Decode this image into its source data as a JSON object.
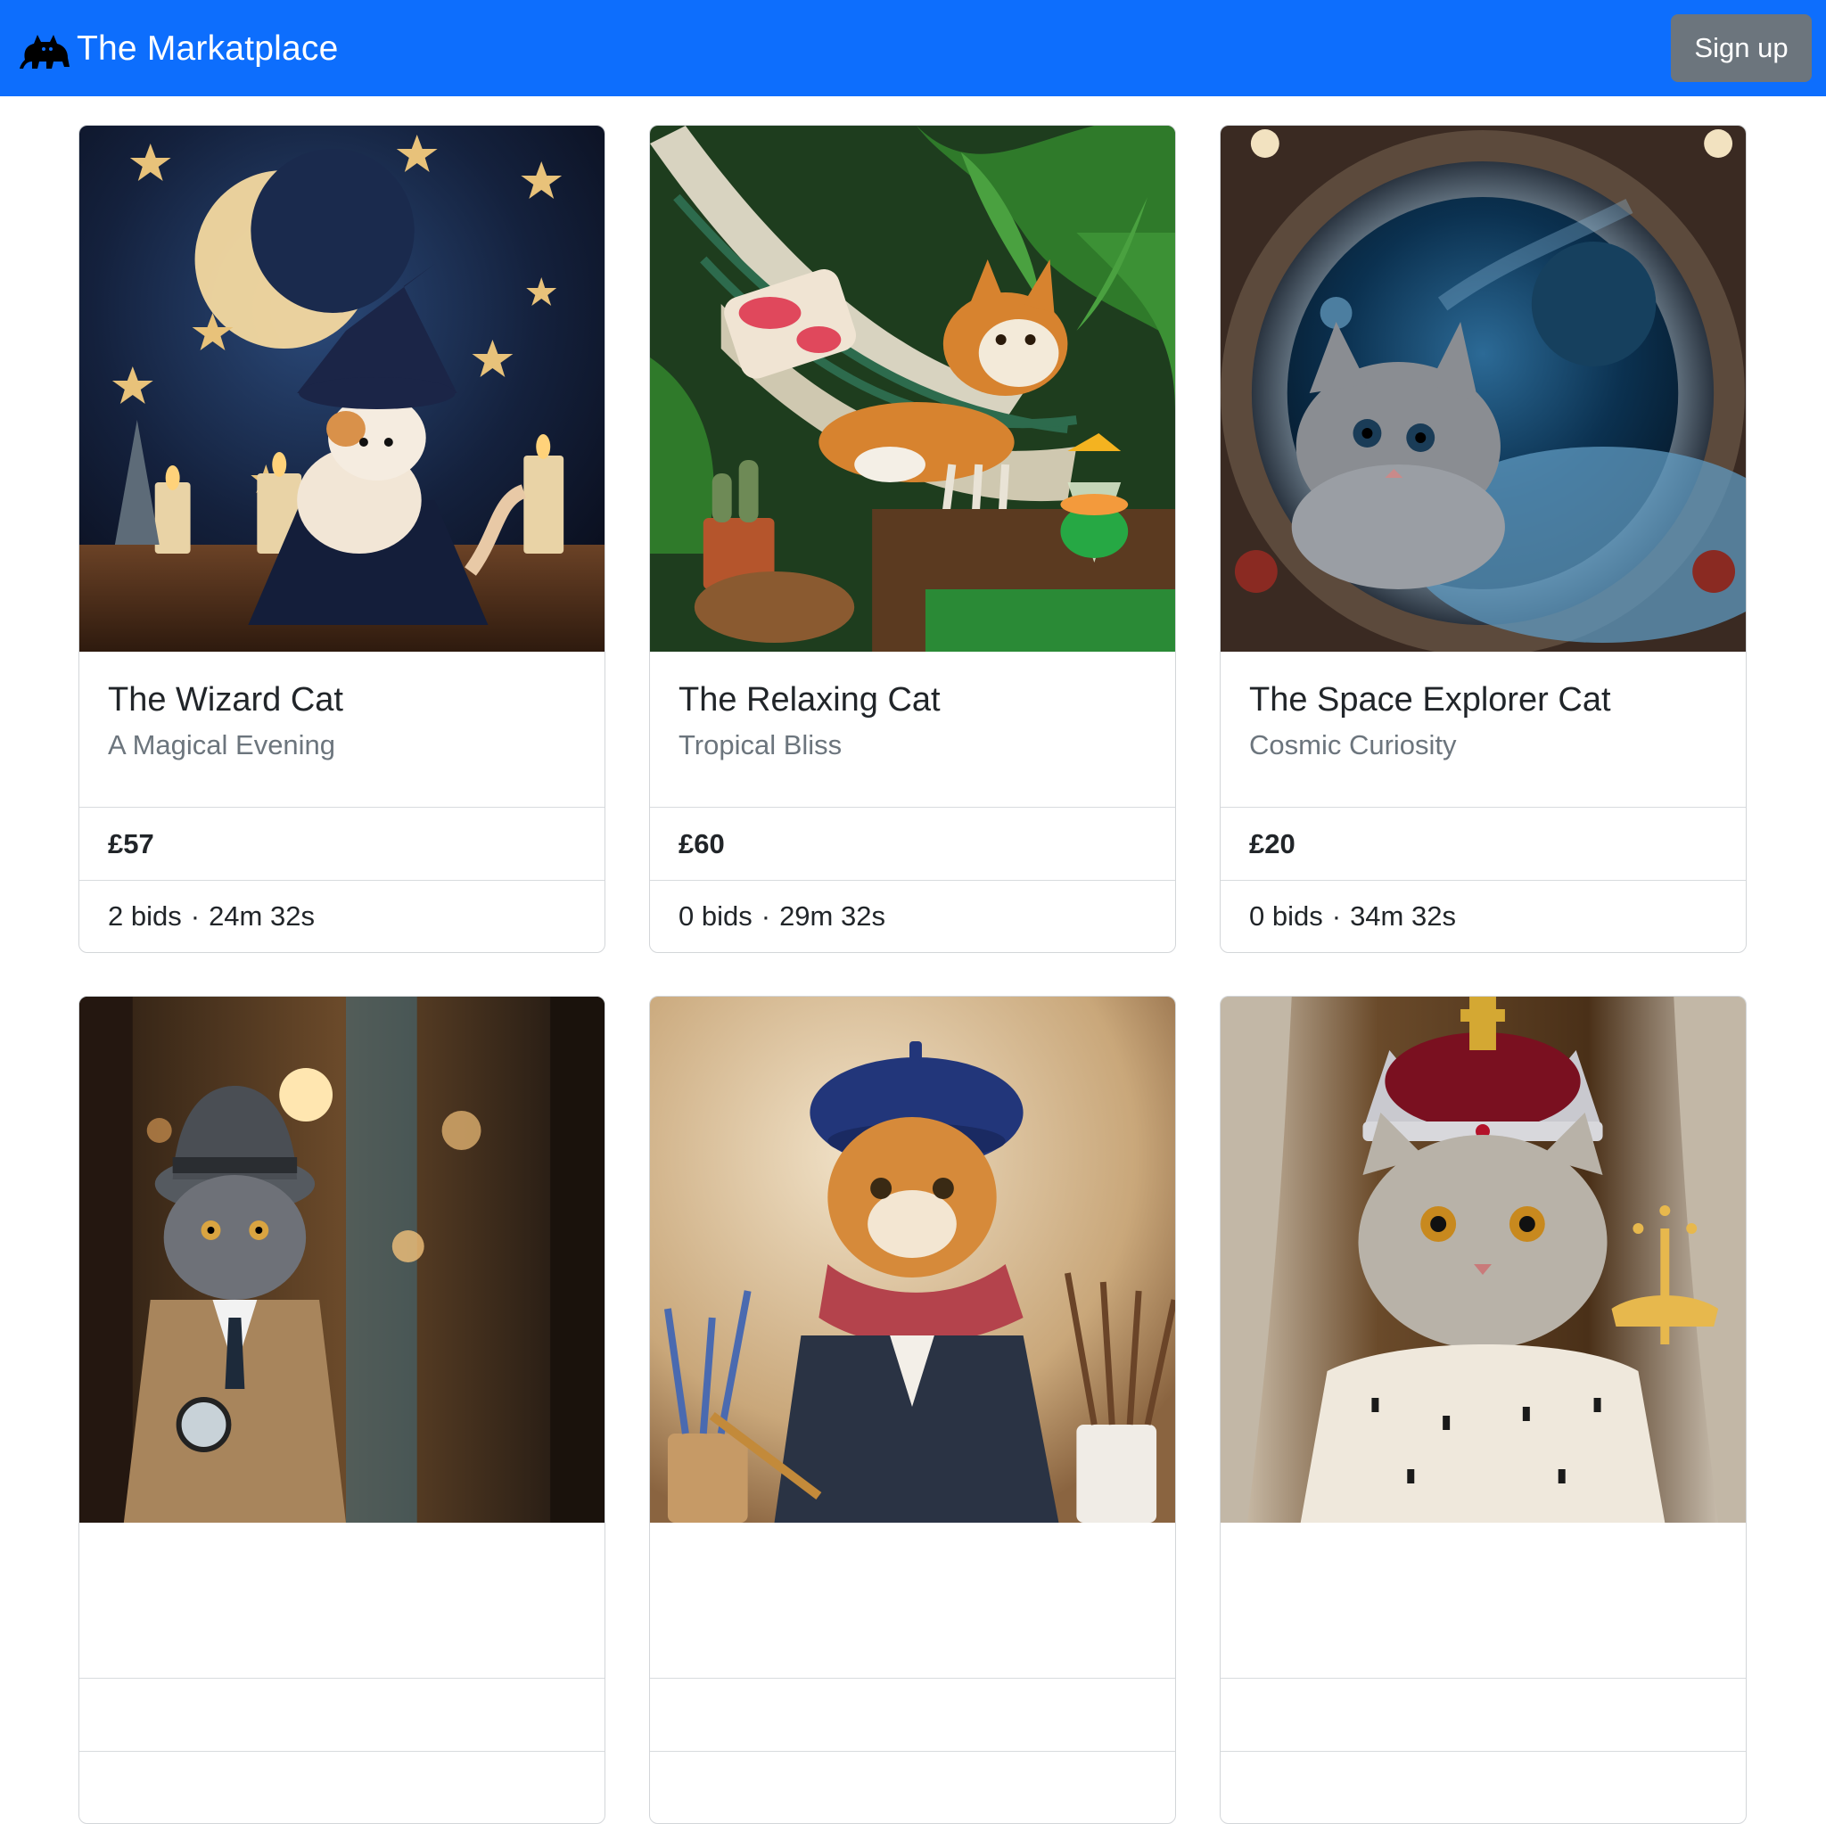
{
  "brand": {
    "name": "The Markatplace",
    "logo_icon": "black-cat-icon"
  },
  "navbar": {
    "signup_label": "Sign up",
    "color": "#0d6efd",
    "button_color": "#6c757d"
  },
  "listings": [
    {
      "title": "The Wizard Cat",
      "subtitle": "A Magical Evening",
      "price": "£57",
      "bids": "2 bids",
      "time_left": "24m 32s"
    },
    {
      "title": "The Relaxing Cat",
      "subtitle": "Tropical Bliss",
      "price": "£60",
      "bids": "0 bids",
      "time_left": "29m 32s"
    },
    {
      "title": "The Space Explorer Cat",
      "subtitle": "Cosmic Curiosity",
      "price": "£20",
      "bids": "0 bids",
      "time_left": "34m 32s"
    },
    {
      "title": "",
      "subtitle": "",
      "price": "",
      "bids": "",
      "time_left": ""
    },
    {
      "title": "",
      "subtitle": "",
      "price": "",
      "bids": "",
      "time_left": ""
    },
    {
      "title": "",
      "subtitle": "",
      "price": "",
      "bids": "",
      "time_left": ""
    }
  ],
  "separator": "·"
}
